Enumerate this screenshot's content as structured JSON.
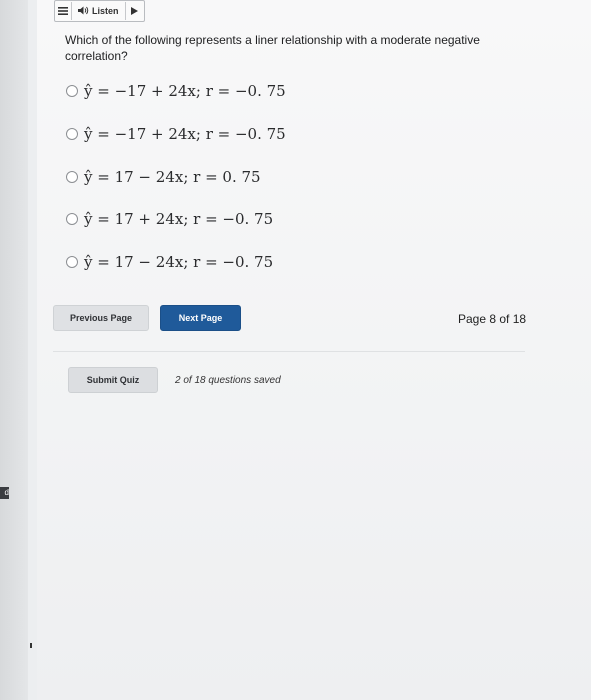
{
  "toolbar": {
    "menu_icon": "hamburger-icon",
    "speaker_icon": "speaker-icon",
    "listen_label": "Listen",
    "play_icon": "play-icon"
  },
  "question": {
    "text": "Which of the following represents a liner relationship with a moderate negative correlation?",
    "options": [
      {
        "label": "ŷ = −17 + 24x;   r = −0. 75"
      },
      {
        "label": "ŷ = −17 + 24x;   r = −0. 75"
      },
      {
        "label": "ŷ = 17 − 24x;   r = 0. 75"
      },
      {
        "label": "ŷ = 17 + 24x;   r = −0. 75"
      },
      {
        "label": "ŷ = 17 − 24x;   r = −0. 75"
      }
    ]
  },
  "navigation": {
    "previous_label": "Previous Page",
    "next_label": "Next Page",
    "page_indicator": "Page 8 of 18"
  },
  "footer": {
    "submit_label": "Submit Quiz",
    "saved_status": "2 of 18 questions saved"
  },
  "edge": {
    "tab_text": "d"
  },
  "colors": {
    "primary_button": "#1f5a9a",
    "secondary_button": "#dfe1e4"
  }
}
